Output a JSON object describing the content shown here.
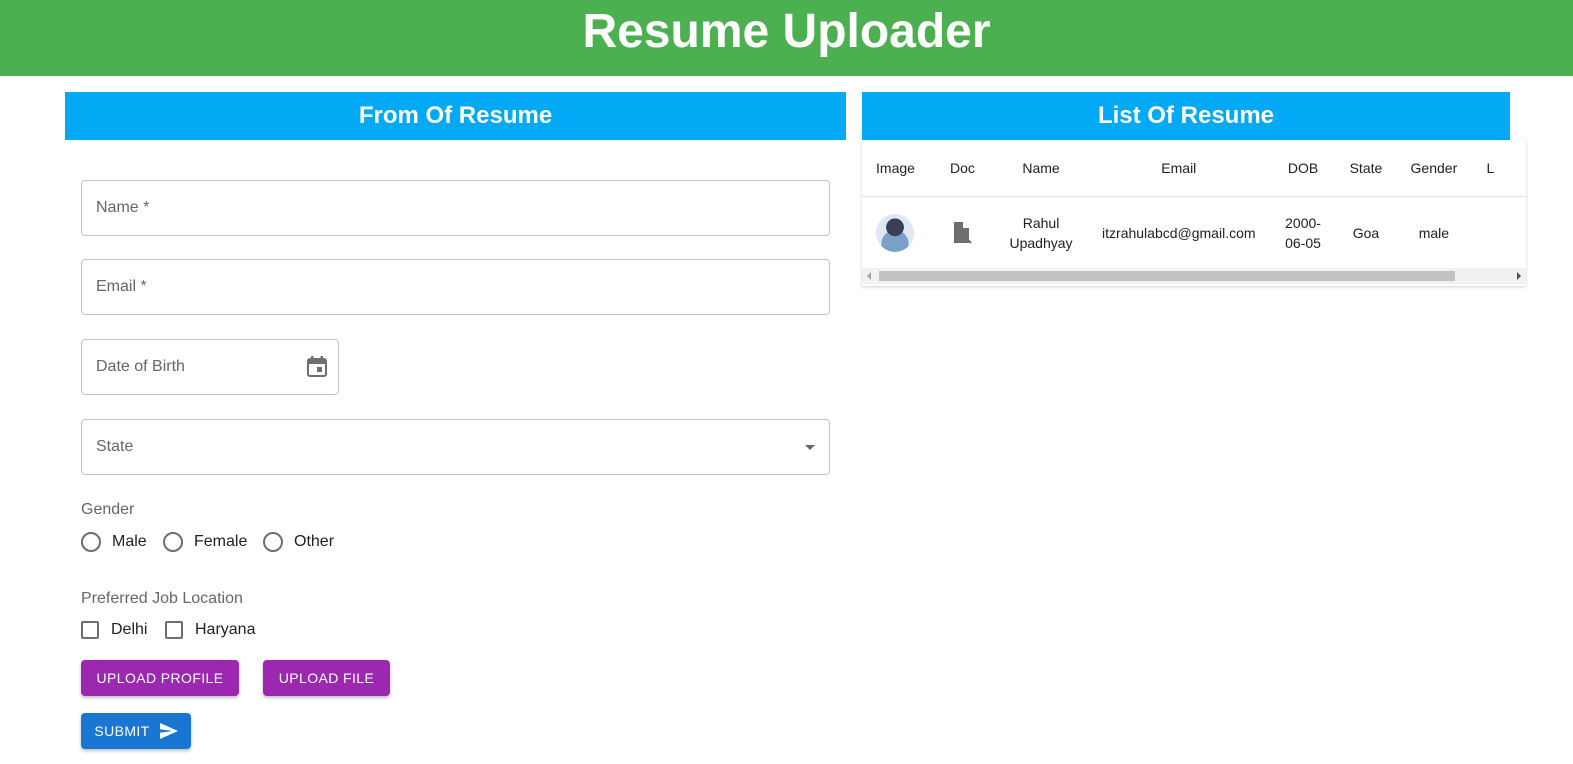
{
  "header": {
    "title": "Resume Uploader"
  },
  "form_panel": {
    "title": "From Of Resume",
    "name_field": {
      "placeholder": "Name *"
    },
    "email_field": {
      "placeholder": "Email *"
    },
    "dob_field": {
      "placeholder": "Date of Birth",
      "icon": "calendar-icon"
    },
    "state_field": {
      "placeholder": "State",
      "icon": "dropdown-arrow-icon"
    },
    "gender": {
      "label": "Gender",
      "options": [
        "Male",
        "Female",
        "Other"
      ]
    },
    "job_location": {
      "label": "Preferred Job Location",
      "options": [
        "Delhi",
        "Haryana"
      ]
    },
    "buttons": {
      "upload_profile": "UPLOAD PROFILE",
      "upload_file": "UPLOAD FILE",
      "submit": "SUBMIT"
    }
  },
  "list_panel": {
    "title": "List Of Resume",
    "columns": [
      "Image",
      "Doc",
      "Name",
      "Email",
      "DOB",
      "State",
      "Gender",
      "L"
    ],
    "rows": [
      {
        "image": "avatar-photo",
        "doc": "file-open-icon",
        "name_line1": "Rahul",
        "name_line2": "Upadhyay",
        "email": "itzrahulabcd@gmail.com",
        "dob_line1": "2000-",
        "dob_line2": "06-05",
        "state": "Goa",
        "gender": "male",
        "location": ""
      }
    ]
  },
  "colors": {
    "appbar": "#4caf50",
    "panel_header": "#03a9f4",
    "upload_buttons": "#9c27b0",
    "submit_button": "#1976d2"
  }
}
